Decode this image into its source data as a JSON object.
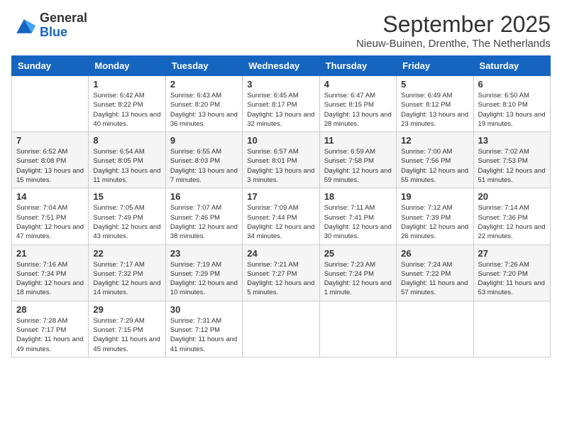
{
  "header": {
    "logo": {
      "line1": "General",
      "line2": "Blue"
    },
    "title": "September 2025",
    "subtitle": "Nieuw-Buinen, Drenthe, The Netherlands"
  },
  "columns": [
    "Sunday",
    "Monday",
    "Tuesday",
    "Wednesday",
    "Thursday",
    "Friday",
    "Saturday"
  ],
  "weeks": [
    [
      {
        "day": "",
        "info": ""
      },
      {
        "day": "1",
        "info": "Sunrise: 6:42 AM\nSunset: 8:22 PM\nDaylight: 13 hours\nand 40 minutes."
      },
      {
        "day": "2",
        "info": "Sunrise: 6:43 AM\nSunset: 8:20 PM\nDaylight: 13 hours\nand 36 minutes."
      },
      {
        "day": "3",
        "info": "Sunrise: 6:45 AM\nSunset: 8:17 PM\nDaylight: 13 hours\nand 32 minutes."
      },
      {
        "day": "4",
        "info": "Sunrise: 6:47 AM\nSunset: 8:15 PM\nDaylight: 13 hours\nand 28 minutes."
      },
      {
        "day": "5",
        "info": "Sunrise: 6:49 AM\nSunset: 8:12 PM\nDaylight: 13 hours\nand 23 minutes."
      },
      {
        "day": "6",
        "info": "Sunrise: 6:50 AM\nSunset: 8:10 PM\nDaylight: 13 hours\nand 19 minutes."
      }
    ],
    [
      {
        "day": "7",
        "info": "Sunrise: 6:52 AM\nSunset: 8:08 PM\nDaylight: 13 hours\nand 15 minutes."
      },
      {
        "day": "8",
        "info": "Sunrise: 6:54 AM\nSunset: 8:05 PM\nDaylight: 13 hours\nand 11 minutes."
      },
      {
        "day": "9",
        "info": "Sunrise: 6:55 AM\nSunset: 8:03 PM\nDaylight: 13 hours\nand 7 minutes."
      },
      {
        "day": "10",
        "info": "Sunrise: 6:57 AM\nSunset: 8:01 PM\nDaylight: 13 hours\nand 3 minutes."
      },
      {
        "day": "11",
        "info": "Sunrise: 6:59 AM\nSunset: 7:58 PM\nDaylight: 12 hours\nand 59 minutes."
      },
      {
        "day": "12",
        "info": "Sunrise: 7:00 AM\nSunset: 7:56 PM\nDaylight: 12 hours\nand 55 minutes."
      },
      {
        "day": "13",
        "info": "Sunrise: 7:02 AM\nSunset: 7:53 PM\nDaylight: 12 hours\nand 51 minutes."
      }
    ],
    [
      {
        "day": "14",
        "info": "Sunrise: 7:04 AM\nSunset: 7:51 PM\nDaylight: 12 hours\nand 47 minutes."
      },
      {
        "day": "15",
        "info": "Sunrise: 7:05 AM\nSunset: 7:49 PM\nDaylight: 12 hours\nand 43 minutes."
      },
      {
        "day": "16",
        "info": "Sunrise: 7:07 AM\nSunset: 7:46 PM\nDaylight: 12 hours\nand 38 minutes."
      },
      {
        "day": "17",
        "info": "Sunrise: 7:09 AM\nSunset: 7:44 PM\nDaylight: 12 hours\nand 34 minutes."
      },
      {
        "day": "18",
        "info": "Sunrise: 7:11 AM\nSunset: 7:41 PM\nDaylight: 12 hours\nand 30 minutes."
      },
      {
        "day": "19",
        "info": "Sunrise: 7:12 AM\nSunset: 7:39 PM\nDaylight: 12 hours\nand 26 minutes."
      },
      {
        "day": "20",
        "info": "Sunrise: 7:14 AM\nSunset: 7:36 PM\nDaylight: 12 hours\nand 22 minutes."
      }
    ],
    [
      {
        "day": "21",
        "info": "Sunrise: 7:16 AM\nSunset: 7:34 PM\nDaylight: 12 hours\nand 18 minutes."
      },
      {
        "day": "22",
        "info": "Sunrise: 7:17 AM\nSunset: 7:32 PM\nDaylight: 12 hours\nand 14 minutes."
      },
      {
        "day": "23",
        "info": "Sunrise: 7:19 AM\nSunset: 7:29 PM\nDaylight: 12 hours\nand 10 minutes."
      },
      {
        "day": "24",
        "info": "Sunrise: 7:21 AM\nSunset: 7:27 PM\nDaylight: 12 hours\nand 5 minutes."
      },
      {
        "day": "25",
        "info": "Sunrise: 7:23 AM\nSunset: 7:24 PM\nDaylight: 12 hours\nand 1 minute."
      },
      {
        "day": "26",
        "info": "Sunrise: 7:24 AM\nSunset: 7:22 PM\nDaylight: 11 hours\nand 57 minutes."
      },
      {
        "day": "27",
        "info": "Sunrise: 7:26 AM\nSunset: 7:20 PM\nDaylight: 11 hours\nand 53 minutes."
      }
    ],
    [
      {
        "day": "28",
        "info": "Sunrise: 7:28 AM\nSunset: 7:17 PM\nDaylight: 11 hours\nand 49 minutes."
      },
      {
        "day": "29",
        "info": "Sunrise: 7:29 AM\nSunset: 7:15 PM\nDaylight: 11 hours\nand 45 minutes."
      },
      {
        "day": "30",
        "info": "Sunrise: 7:31 AM\nSunset: 7:12 PM\nDaylight: 11 hours\nand 41 minutes."
      },
      {
        "day": "",
        "info": ""
      },
      {
        "day": "",
        "info": ""
      },
      {
        "day": "",
        "info": ""
      },
      {
        "day": "",
        "info": ""
      }
    ]
  ]
}
